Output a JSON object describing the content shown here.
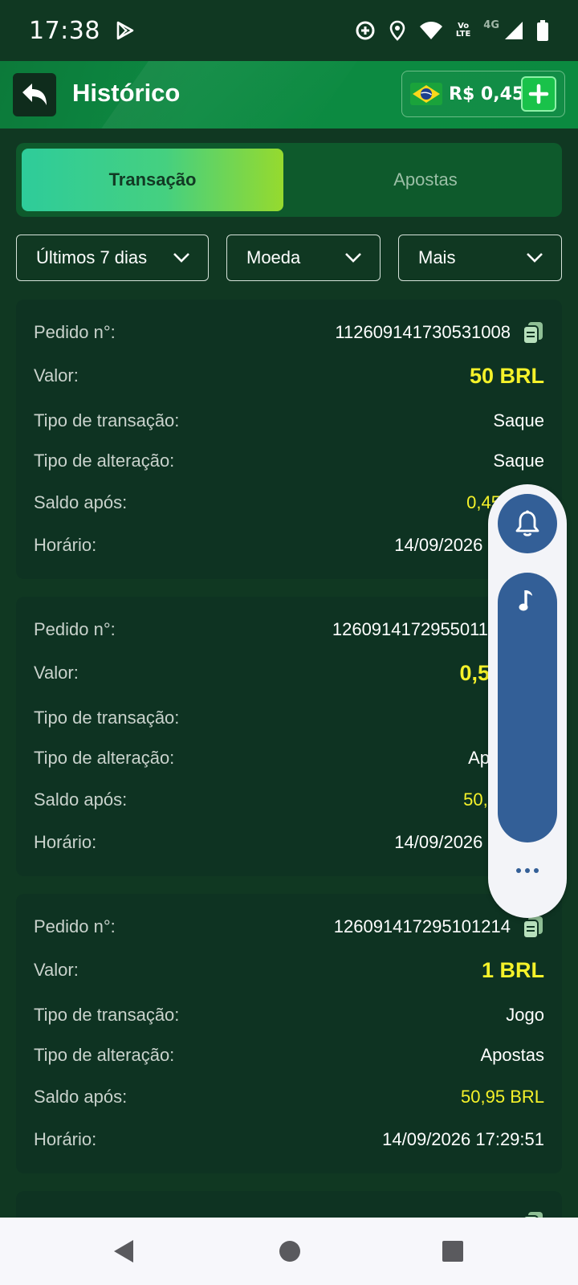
{
  "status_bar": {
    "time": "17:38",
    "network_label": "4G",
    "icons": [
      "play-store-icon",
      "data-saver-icon",
      "location-icon",
      "wifi-icon",
      "volte-icon",
      "signal-icon",
      "battery-icon"
    ]
  },
  "header": {
    "title": "Histórico",
    "balance": "R$ 0,45",
    "back_icon": "back-arrow-icon",
    "add_icon": "plus-icon",
    "flag": "brazil-flag"
  },
  "tabs": [
    {
      "label": "Transação",
      "active": true
    },
    {
      "label": "Apostas",
      "active": false
    }
  ],
  "filters": [
    {
      "label": "Últimos 7 dias"
    },
    {
      "label": "Moeda"
    },
    {
      "label": "Mais"
    }
  ],
  "field_labels": {
    "order": "Pedido n°:",
    "value": "Valor:",
    "transaction_type": "Tipo de transação:",
    "change_type": "Tipo de alteração:",
    "balance_after": "Saldo após:",
    "time": "Horário:"
  },
  "transactions": [
    {
      "order": "112609141730531008",
      "value": "50 BRL",
      "transaction_type": "Saque",
      "change_type": "Saque",
      "balance_after": "0,45",
      "time": "14/09/2026 17"
    },
    {
      "order": "1260914172955011",
      "value": "0,5",
      "transaction_type": "",
      "change_type": "Ap",
      "balance_after": "50,4",
      "time": "14/09/2026 17"
    },
    {
      "order": "126091417295101214",
      "value": "1 BRL",
      "transaction_type": "Jogo",
      "change_type": "Apostas",
      "balance_after": "50,95 BRL",
      "time": "14/09/2026 17:29:51"
    }
  ],
  "colors": {
    "background": "#103822",
    "header": "#0b8a40",
    "card": "#0e3322",
    "accent_yellow": "#f5f22a",
    "widget_blue": "#335f97"
  }
}
